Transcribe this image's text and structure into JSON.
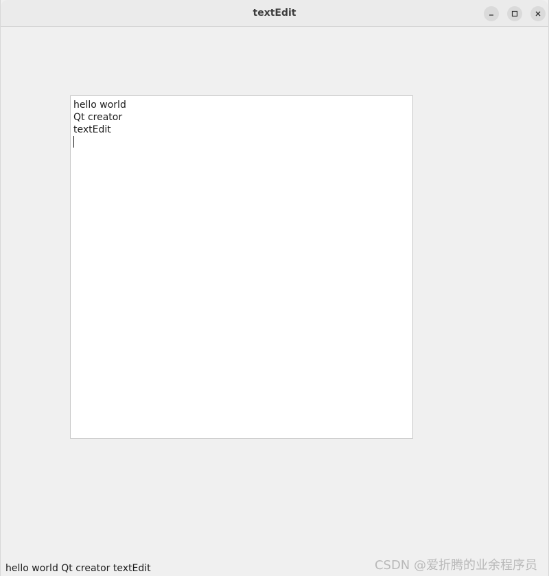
{
  "window": {
    "title": "textEdit"
  },
  "editor": {
    "lines": [
      "hello world",
      "Qt creator",
      "textEdit"
    ]
  },
  "status": {
    "text": "hello world Qt creator textEdit"
  },
  "watermark": {
    "text": "CSDN @爱折腾的业余程序员"
  },
  "icons": {
    "minimize": "minimize-icon",
    "maximize": "maximize-icon",
    "close": "close-icon"
  }
}
